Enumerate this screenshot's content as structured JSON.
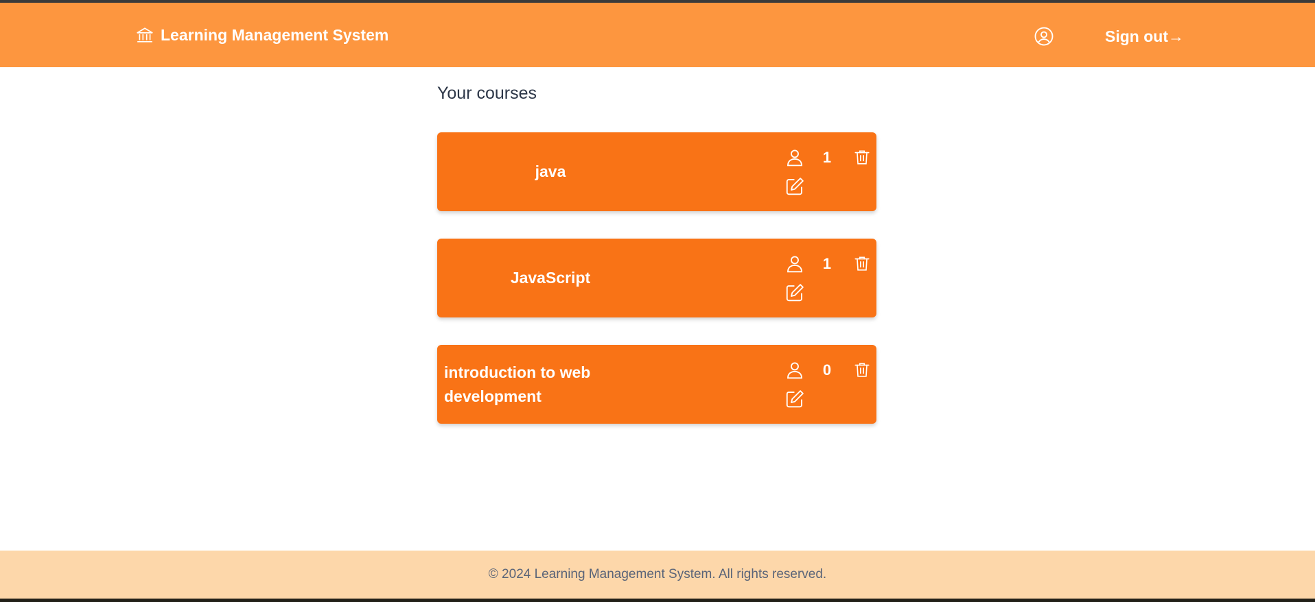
{
  "header": {
    "brand_icon": "bank-building-icon",
    "title": "Learning Management System",
    "profile_icon": "user-circle-icon",
    "signout_label": "Sign out→",
    "bg_color": "#fd963f"
  },
  "main": {
    "heading": "Your courses",
    "courses": [
      {
        "title": "java",
        "enrolled_count": "1"
      },
      {
        "title": "JavaScript",
        "enrolled_count": "1"
      },
      {
        "title": "introduction to web development",
        "enrolled_count": "0"
      }
    ],
    "card_color": "#f97316",
    "icons": [
      "user-icon",
      "edit-icon",
      "trash-icon"
    ]
  },
  "footer": {
    "text": "© 2024 Learning Management System. All rights reserved.",
    "bg_color": "#fdd7aa"
  }
}
